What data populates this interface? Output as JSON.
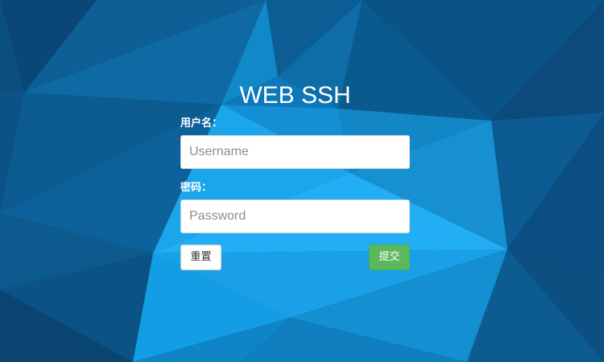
{
  "page": {
    "title": "WEB SSH"
  },
  "form": {
    "username_label": "用户名：",
    "username_placeholder": "Username",
    "username_value": "",
    "password_label": "密码：",
    "password_placeholder": "Password",
    "password_value": "",
    "reset_label": "重置",
    "submit_label": "提交"
  },
  "colors": {
    "background_dark": "#0b4f80",
    "background_light": "#00a0f0",
    "submit_button": "#5cb85c",
    "reset_button": "#ffffff"
  }
}
